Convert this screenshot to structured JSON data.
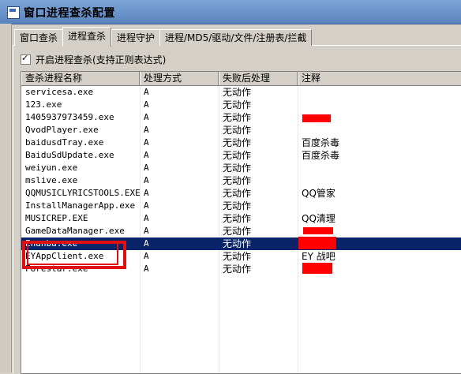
{
  "window": {
    "title": "窗口进程查杀配置",
    "icon": "app-icon"
  },
  "tabs": [
    {
      "label": "窗口查杀",
      "active": false
    },
    {
      "label": "进程查杀",
      "active": true
    },
    {
      "label": "进程守护",
      "active": false
    },
    {
      "label": "进程/MD5/驱动/文件/注册表/拦截",
      "active": false
    }
  ],
  "checkbox": {
    "label": "开启进程查杀(支持正则表达式)",
    "checked": true
  },
  "table": {
    "columns": [
      "查杀进程名称",
      "处理方式",
      "失败后处理",
      "注释"
    ],
    "rows": [
      {
        "name": "servicesa.exe",
        "method": "A",
        "fail": "无动作",
        "note": ""
      },
      {
        "name": "123.exe",
        "method": "A",
        "fail": "无动作",
        "note": ""
      },
      {
        "name": "1405937973459.exe",
        "method": "A",
        "fail": "无动作",
        "note": ""
      },
      {
        "name": "QvodPlayer.exe",
        "method": "A",
        "fail": "无动作",
        "note": ""
      },
      {
        "name": "baidusdTray.exe",
        "method": "A",
        "fail": "无动作",
        "note": "百度杀毒"
      },
      {
        "name": "BaiduSdUpdate.exe",
        "method": "A",
        "fail": "无动作",
        "note": "百度杀毒"
      },
      {
        "name": "weiyun.exe",
        "method": "A",
        "fail": "无动作",
        "note": ""
      },
      {
        "name": "mslive.exe",
        "method": "A",
        "fail": "无动作",
        "note": ""
      },
      {
        "name": "QQMUSICLYRICSTOOLS.EXE",
        "method": "A",
        "fail": "无动作",
        "note": "QQ管家"
      },
      {
        "name": "InstallManagerApp.exe",
        "method": "A",
        "fail": "无动作",
        "note": ""
      },
      {
        "name": "MUSICREP.EXE",
        "method": "A",
        "fail": "无动作",
        "note": "QQ清理"
      },
      {
        "name": "GameDataManager.exe",
        "method": "A",
        "fail": "无动作",
        "note": ""
      },
      {
        "name": "Enanba.exe",
        "method": "A",
        "fail": "无动作",
        "note": ""
      },
      {
        "name": "EYAppClient.exe",
        "method": "A",
        "fail": "无动作",
        "note": "EY 战吧"
      },
      {
        "name": "Forestar.exe",
        "method": "A",
        "fail": "无动作",
        "note": ""
      }
    ],
    "selected_row_index": 12
  },
  "colors": {
    "selection": "#0a246a",
    "annotation": "#e01010",
    "redaction": "#ff0000"
  }
}
